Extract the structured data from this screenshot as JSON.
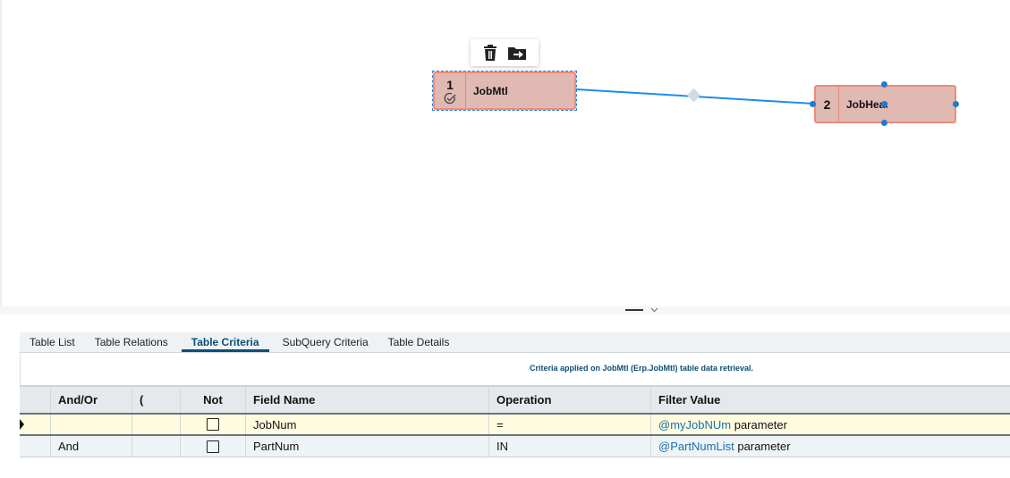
{
  "diagram": {
    "toolbar": {
      "delete_icon": "trash-icon",
      "move_icon": "folder-arrow-icon"
    },
    "nodes": [
      {
        "number": "1",
        "name": "JobMtl",
        "status_icon": "check-circle-icon"
      },
      {
        "number": "2",
        "name": "JobHead"
      }
    ]
  },
  "tabs": [
    {
      "label": "Table List"
    },
    {
      "label": "Table Relations"
    },
    {
      "label": "Table Criteria",
      "active": true
    },
    {
      "label": "SubQuery Criteria"
    },
    {
      "label": "Table Details"
    }
  ],
  "message": "Criteria applied on JobMtl (Erp.JobMtl) table data retrieval.",
  "grid": {
    "columns": [
      "And/Or",
      "(",
      "Not",
      "Field Name",
      "Operation",
      "Filter Value"
    ],
    "rows": [
      {
        "and_or": "",
        "paren": "",
        "not": false,
        "field": "JobNum",
        "operation": "=",
        "param": "@myJobNUm",
        "suffix": "parameter"
      },
      {
        "and_or": "And",
        "paren": "",
        "not": false,
        "field": "PartNum",
        "operation": "IN",
        "param": "@PartNumList",
        "suffix": "parameter"
      }
    ]
  },
  "colors": {
    "accent": "#0b4f7a",
    "node_fill": "#e0b9b2",
    "node_border": "#f08a78",
    "link": "#1f8ceb"
  }
}
